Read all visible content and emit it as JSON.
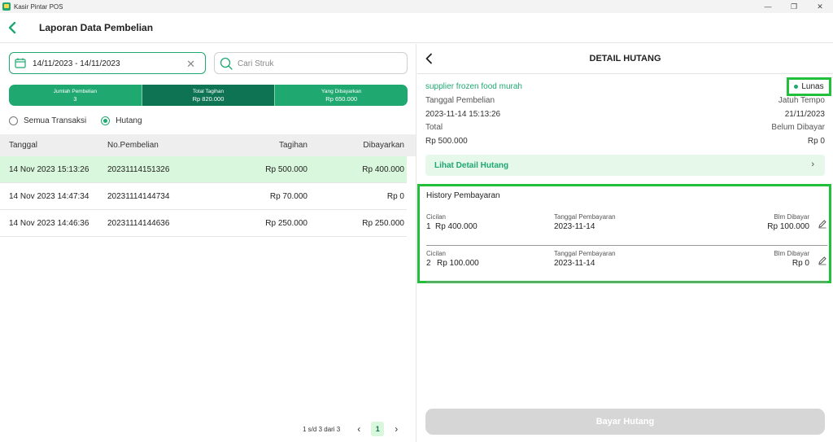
{
  "window": {
    "title": "Kasir Pintar POS",
    "minimize": "—",
    "maximize": "❐",
    "close": "✕"
  },
  "header": {
    "title": "Laporan Data Pembelian"
  },
  "filter": {
    "date_range": "14/11/2023 - 14/11/2023",
    "search_placeholder": "Cari Struk"
  },
  "stats": [
    {
      "label": "Jumlah Pembelian",
      "value": "3"
    },
    {
      "label": "Total Tagihan",
      "value": "Rp 820.000"
    },
    {
      "label": "Yang Dibayarkan",
      "value": "Rp 650.000"
    }
  ],
  "radio": {
    "all_label": "Semua Transaksi",
    "debt_label": "Hutang"
  },
  "table": {
    "headers": [
      "Tanggal",
      "No.Pembelian",
      "Tagihan",
      "Dibayarkan"
    ],
    "rows": [
      {
        "date": "14 Nov 2023 15:13:26",
        "number": "20231114151326",
        "bill": "Rp 500.000",
        "paid": "Rp 400.000"
      },
      {
        "date": "14 Nov 2023 14:47:34",
        "number": "20231114144734",
        "bill": "Rp 70.000",
        "paid": "Rp 0"
      },
      {
        "date": "14 Nov 2023 14:46:36",
        "number": "20231114144636",
        "bill": "Rp 250.000",
        "paid": "Rp 250.000"
      }
    ]
  },
  "pagination": {
    "info": "1 s/d 3 dari 3",
    "prev": "‹",
    "page": "1",
    "next": "›"
  },
  "detail": {
    "title": "DETAIL HUTANG",
    "supplier": "supplier frozen food murah",
    "status": "Lunas",
    "purchase_date_label": "Tanggal Pembelian",
    "due_date_label": "Jatuh Tempo",
    "purchase_date": "2023-11-14 15:13:26",
    "due_date": "21/11/2023",
    "total_label": "Total",
    "unpaid_label": "Belum Dibayar",
    "total": "Rp 500.000",
    "unpaid": "Rp 0",
    "view_detail": "Lihat Detail Hutang",
    "chevron": "›"
  },
  "history": {
    "title": "History Pembayaran",
    "installment_label": "Cicilan",
    "pay_date_label": "Tanggal Pembayaran",
    "remaining_label": "Blm Dibayar",
    "items": [
      {
        "no": "1",
        "amount": "Rp 400.000",
        "date": "2023-11-14",
        "remaining": "Rp 100.000"
      },
      {
        "no": "2",
        "amount": "Rp 100.000",
        "date": "2023-11-14",
        "remaining": "Rp 0"
      }
    ]
  },
  "footer": {
    "pay_button": "Bayar Hutang"
  },
  "colors": {
    "primary": "#1fa870",
    "primary_dark": "#0e7352",
    "highlight": "#22bf3a",
    "selected_row": "#d9f7dc"
  }
}
